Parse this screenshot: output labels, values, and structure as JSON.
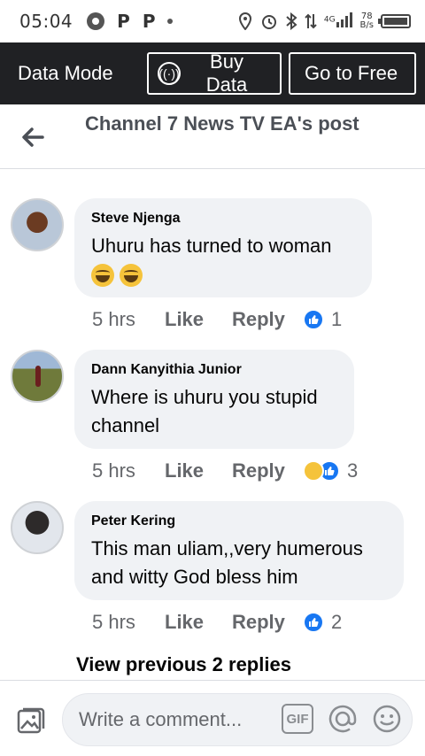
{
  "status_bar": {
    "time": "05:04",
    "network_type": "4G",
    "net_speed_value": "78",
    "net_speed_unit": "B/s"
  },
  "data_bar": {
    "mode_label": "Data Mode",
    "buy_data_label": "Buy Data",
    "go_free_label": "Go to Free"
  },
  "post_header": {
    "title": "Channel 7 News TV EA's post"
  },
  "comments": [
    {
      "author": "Steve Njenga",
      "text": "Uhuru has turned to woman",
      "emoji": [
        "grinning-squinting-face",
        "grinning-squinting-face"
      ],
      "time": "5 hrs",
      "like_label": "Like",
      "reply_label": "Reply",
      "reactions": [
        "like"
      ],
      "reaction_count": "1"
    },
    {
      "author": "Dann Kanyithia Junior",
      "text": "Where is uhuru you stupid channel",
      "time": "5 hrs",
      "like_label": "Like",
      "reply_label": "Reply",
      "reactions": [
        "haha",
        "like"
      ],
      "reaction_count": "3"
    },
    {
      "author": "Peter Kering",
      "text": "This man uliam,,very humerous and witty God bless him",
      "time": "5 hrs",
      "like_label": "Like",
      "reply_label": "Reply",
      "reactions": [
        "like"
      ],
      "reaction_count": "2"
    }
  ],
  "view_previous": "View previous 2 replies",
  "composer": {
    "placeholder": "Write a comment...",
    "gif_label": "GIF"
  },
  "colors": {
    "data_bar_bg": "#202124",
    "bubble_bg": "#f0f2f5",
    "like_blue": "#1877f2",
    "meta_gray": "#65676b"
  }
}
